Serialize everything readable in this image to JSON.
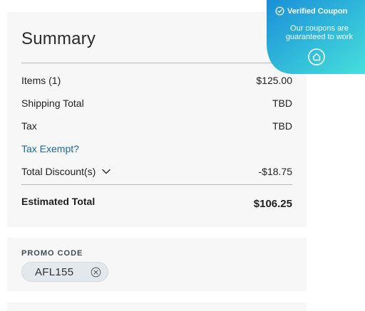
{
  "summary": {
    "title": "Summary",
    "rows": {
      "items": {
        "label": "Items (1)",
        "value": "$125.00"
      },
      "shipping": {
        "label": "Shipping Total",
        "value": "TBD"
      },
      "tax": {
        "label": "Tax",
        "value": "TBD"
      },
      "discount": {
        "label": "Total Discount(s)",
        "value": "-$18.75"
      }
    },
    "tax_exempt_link": "Tax Exempt?",
    "estimated": {
      "label": "Estimated Total",
      "value": "$106.25"
    }
  },
  "promo": {
    "label": "PROMO CODE",
    "code": "AFL155"
  },
  "badge": {
    "title": "Verified Coupon",
    "subtitle_line1": "Our coupons are",
    "subtitle_line2": "guaranteed to work",
    "gradient_start": "#1a8fd8",
    "gradient_end": "#45e0dc"
  },
  "icons": {
    "discount_toggle": "chevron-down-icon",
    "promo_remove": "close-circle-icon",
    "verified": "check-circle-icon",
    "brand": "house-circle-icon"
  }
}
